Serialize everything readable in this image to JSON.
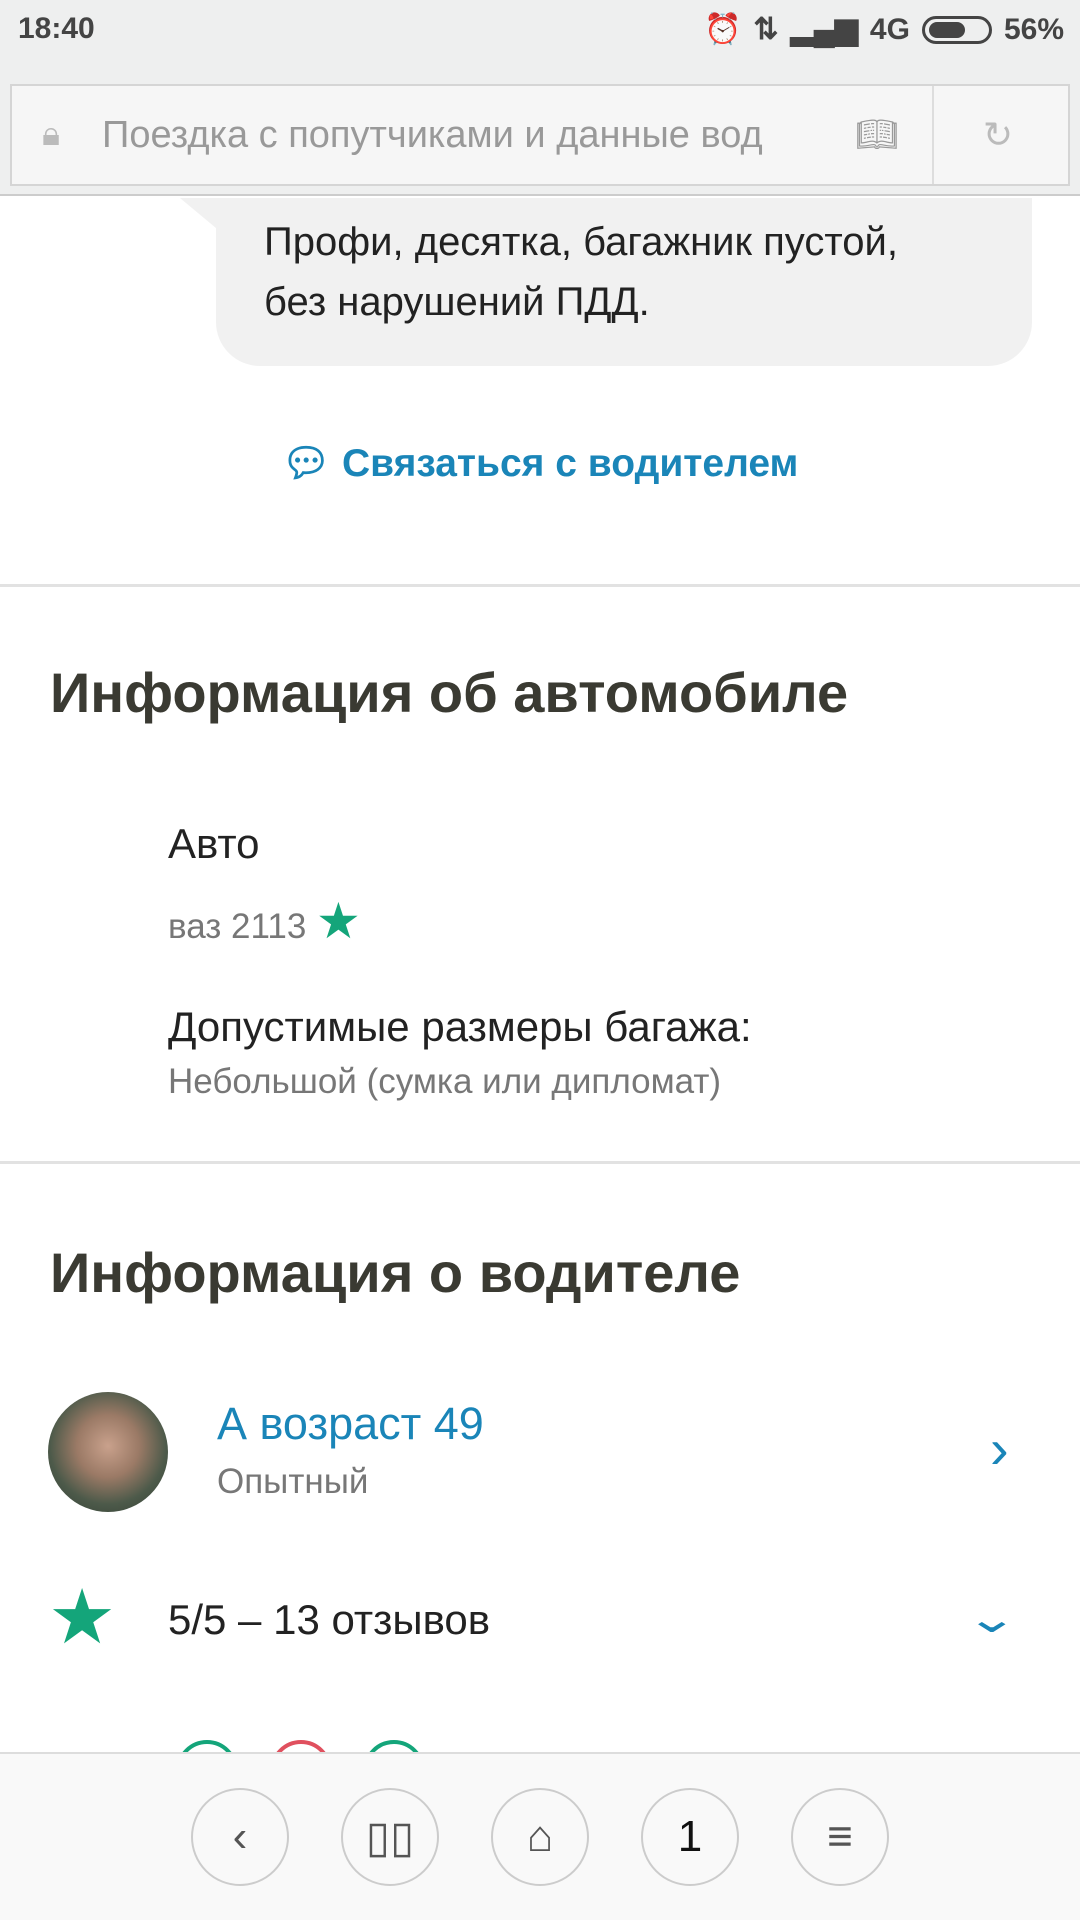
{
  "status_bar": {
    "time": "18:40",
    "network": "4G",
    "battery": "56%",
    "battery_level": 0.56
  },
  "browser": {
    "page_title": "Поездка с попутчиками и данные вод",
    "icons": {
      "lock": "lock-icon",
      "reader": "book-icon",
      "reload": "reload-icon"
    }
  },
  "comment": {
    "text_line1": "Профи, десятка, багажник пустой,",
    "text_line2": "без нарушений ПДД."
  },
  "contact_link": "Связаться с водителем",
  "car_section": {
    "heading": "Информация об автомобиле",
    "car_label": "Авто",
    "car_value": "ваз 2113",
    "luggage_label": "Допустимые размеры багажа:",
    "luggage_value": "Небольшой (сумка или дипломат)"
  },
  "driver_section": {
    "heading": "Информация о водителе",
    "name": "А возраст 49",
    "experience": "Опытный",
    "rating": "5/5 – 13 отзывов"
  },
  "bottom_nav": {
    "tabs_count": "1"
  },
  "colors": {
    "accent": "#1a85b8",
    "star": "#14a57a",
    "negative": "#e0505e"
  }
}
